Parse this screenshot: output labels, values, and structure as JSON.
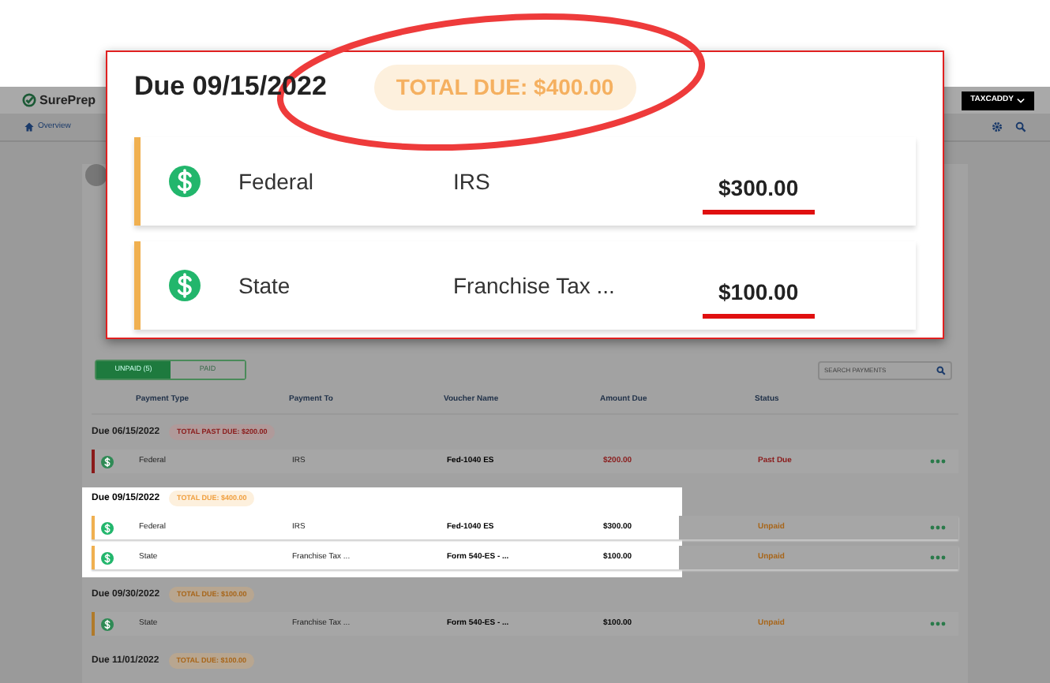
{
  "app": {
    "logo": "SurePrep",
    "account_button": "TAXCADDY",
    "nav": [
      {
        "label": "Overview",
        "selected": true
      }
    ]
  },
  "payments": {
    "tabs": [
      {
        "label": "UNPAID (5)",
        "selected": true
      },
      {
        "label": "PAID",
        "selected": false
      }
    ],
    "search": {
      "placeholder": "SEARCH PAYMENTS"
    },
    "columns": [
      "Payment Type",
      "Payment To",
      "Voucher Name",
      "Amount Due",
      "Status"
    ],
    "groups": [
      {
        "due": "Due 06/15/2022",
        "total": "TOTAL PAST DUE: $200.00",
        "kind": "past_due",
        "highlighted": false,
        "rows": [
          {
            "type": "Federal",
            "to": "IRS",
            "voucher": "Fed-1040 ES",
            "amount": "$200.00",
            "status": "Past Due"
          }
        ]
      },
      {
        "due": "Due 09/15/2022",
        "total": "TOTAL DUE: $400.00",
        "kind": "due",
        "highlighted": true,
        "rows": [
          {
            "type": "Federal",
            "to": "IRS",
            "voucher": "Fed-1040 ES",
            "amount": "$300.00",
            "status": "Unpaid"
          },
          {
            "type": "State",
            "to": "Franchise Tax ...",
            "voucher": "Form 540-ES - ...",
            "amount": "$100.00",
            "status": "Unpaid"
          }
        ]
      },
      {
        "due": "Due 09/30/2022",
        "total": "TOTAL DUE: $100.00",
        "kind": "due",
        "highlighted": false,
        "rows": [
          {
            "type": "State",
            "to": "Franchise Tax ...",
            "voucher": "Form 540-ES - ...",
            "amount": "$100.00",
            "status": "Unpaid"
          }
        ]
      },
      {
        "due": "Due 11/01/2022",
        "total": "TOTAL DUE: $100.00",
        "kind": "due",
        "highlighted": false
      }
    ]
  },
  "callout": {
    "due": "Due 09/15/2022",
    "total": "TOTAL DUE: $400.00",
    "rows": [
      {
        "type": "Federal",
        "to": "IRS",
        "amount": "$300.00"
      },
      {
        "type": "State",
        "to": "Franchise Tax ...",
        "amount": "$100.00"
      }
    ]
  }
}
